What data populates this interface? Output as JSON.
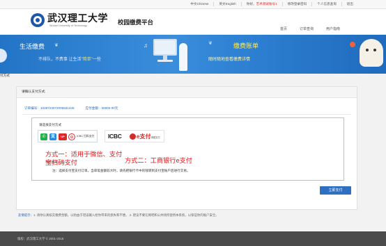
{
  "topbar": {
    "links": [
      {
        "label": "中文Chinese",
        "red": false
      },
      {
        "label": "英文English",
        "red": false
      },
      {
        "label": "你好，",
        "red": false
      },
      {
        "label": "艺术测试账号1",
        "red": true
      },
      {
        "label": "修改登录密码",
        "red": false
      },
      {
        "label": "个人信息查询",
        "red": false
      },
      {
        "label": "退出",
        "red": false
      }
    ]
  },
  "header": {
    "school_name": "武汉理工大学",
    "school_name_en": "Wuhan University of Technology",
    "system_title": "校园缴费平台",
    "nav": [
      "首页",
      "订单查询",
      "用户指南"
    ]
  },
  "banner": {
    "left_title": "生活缴费",
    "left_sub_a": "不排队，不费事   让生活",
    "left_sub_b": "\"简单\"",
    "left_sub_c": "一些",
    "right_title": "缴费账单",
    "right_sub": "随时随地查看缴费详情"
  },
  "breadcrumb": "付方式",
  "panel": {
    "header": "请确认支付方式",
    "order_label": "订单编号：",
    "order_no": "1049723072005531445",
    "amount_label": "应付金额：",
    "amount": "30000.00元",
    "choose_label": "请选择支付方式",
    "option1_label": "ICBC 扫码支付",
    "option2_brand": "ICBC",
    "option2_epay": "e支付",
    "option2_tag": "网银支付",
    "annotation1": "方式一：适用于微信、支付宝扫码支付",
    "annotation2": "方式二：工商银行e支付",
    "fee_label": "手续费用（元）:",
    "note": "注：选择支付宝支付订单，当单笔金额较大时，请先把银行卡中的钱转到支付宝账户后进行交易。",
    "pay_button": "立即支付"
  },
  "tips": {
    "label": "友情提示：",
    "text": "1. 请你认真核实缴费金额，以防由于错误输入给你带来的损失和不便。   2. 建议不要在网吧和公共场所使用本系统，以保证你的账户安全。"
  },
  "footer": "版权：武汉理工大学 © 2001-2018",
  "colors": {
    "banner_blue": "#2f82d4",
    "link_blue": "#2a67b5",
    "annotation_red": "#e4161a",
    "pay_button": "#2d6fc1"
  },
  "icons": [
    "logo-emblem",
    "wechat-icon",
    "alipay-icon",
    "unionpay-icon",
    "scan-icon",
    "icbc-logo-icon"
  ]
}
